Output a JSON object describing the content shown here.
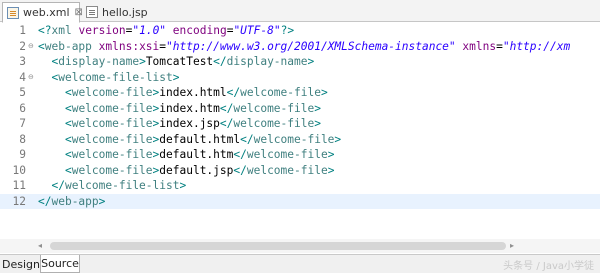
{
  "tabs": [
    {
      "label": "web.xml",
      "active": true,
      "icon": "xml-file-icon",
      "close": "⊠"
    },
    {
      "label": "hello.jsp",
      "active": false,
      "icon": "jsp-file-icon"
    }
  ],
  "editor": {
    "current_line": 12,
    "lines": [
      {
        "n": "1",
        "fold": "",
        "tokens": [
          {
            "t": "br",
            "v": "<?"
          },
          {
            "t": "tag",
            "v": "xml"
          },
          {
            "t": "txt",
            "v": " "
          },
          {
            "t": "attr",
            "v": "version"
          },
          {
            "t": "eq",
            "v": "="
          },
          {
            "t": "val",
            "v": "\"1.0\""
          },
          {
            "t": "txt",
            "v": " "
          },
          {
            "t": "attr",
            "v": "encoding"
          },
          {
            "t": "eq",
            "v": "="
          },
          {
            "t": "val",
            "v": "\"UTF-8\""
          },
          {
            "t": "br",
            "v": "?>"
          }
        ]
      },
      {
        "n": "2",
        "fold": "⊖",
        "tokens": [
          {
            "t": "br",
            "v": "<"
          },
          {
            "t": "tag",
            "v": "web-app"
          },
          {
            "t": "txt",
            "v": " "
          },
          {
            "t": "attr",
            "v": "xmlns:xsi"
          },
          {
            "t": "eq",
            "v": "="
          },
          {
            "t": "val",
            "v": "\"http://www.w3.org/2001/XMLSchema-instance\""
          },
          {
            "t": "txt",
            "v": " "
          },
          {
            "t": "attr",
            "v": "xmlns"
          },
          {
            "t": "eq",
            "v": "="
          },
          {
            "t": "val",
            "v": "\"http://xm"
          }
        ]
      },
      {
        "n": "3",
        "fold": "",
        "tokens": [
          {
            "t": "txt",
            "v": "  "
          },
          {
            "t": "br",
            "v": "<"
          },
          {
            "t": "tag",
            "v": "display-name"
          },
          {
            "t": "br",
            "v": ">"
          },
          {
            "t": "txt",
            "v": "TomcatTest"
          },
          {
            "t": "br",
            "v": "</"
          },
          {
            "t": "tag",
            "v": "display-name"
          },
          {
            "t": "br",
            "v": ">"
          }
        ]
      },
      {
        "n": "4",
        "fold": "⊖",
        "tokens": [
          {
            "t": "txt",
            "v": "  "
          },
          {
            "t": "br",
            "v": "<"
          },
          {
            "t": "tag",
            "v": "welcome-file-list"
          },
          {
            "t": "br",
            "v": ">"
          }
        ]
      },
      {
        "n": "5",
        "fold": "",
        "tokens": [
          {
            "t": "txt",
            "v": "    "
          },
          {
            "t": "br",
            "v": "<"
          },
          {
            "t": "tag",
            "v": "welcome-file"
          },
          {
            "t": "br",
            "v": ">"
          },
          {
            "t": "txt",
            "v": "index.html"
          },
          {
            "t": "br",
            "v": "</"
          },
          {
            "t": "tag",
            "v": "welcome-file"
          },
          {
            "t": "br",
            "v": ">"
          }
        ]
      },
      {
        "n": "6",
        "fold": "",
        "tokens": [
          {
            "t": "txt",
            "v": "    "
          },
          {
            "t": "br",
            "v": "<"
          },
          {
            "t": "tag",
            "v": "welcome-file"
          },
          {
            "t": "br",
            "v": ">"
          },
          {
            "t": "txt",
            "v": "index.htm"
          },
          {
            "t": "br",
            "v": "</"
          },
          {
            "t": "tag",
            "v": "welcome-file"
          },
          {
            "t": "br",
            "v": ">"
          }
        ]
      },
      {
        "n": "7",
        "fold": "",
        "tokens": [
          {
            "t": "txt",
            "v": "    "
          },
          {
            "t": "br",
            "v": "<"
          },
          {
            "t": "tag",
            "v": "welcome-file"
          },
          {
            "t": "br",
            "v": ">"
          },
          {
            "t": "txt",
            "v": "index.jsp"
          },
          {
            "t": "br",
            "v": "</"
          },
          {
            "t": "tag",
            "v": "welcome-file"
          },
          {
            "t": "br",
            "v": ">"
          }
        ]
      },
      {
        "n": "8",
        "fold": "",
        "tokens": [
          {
            "t": "txt",
            "v": "    "
          },
          {
            "t": "br",
            "v": "<"
          },
          {
            "t": "tag",
            "v": "welcome-file"
          },
          {
            "t": "br",
            "v": ">"
          },
          {
            "t": "txt",
            "v": "default.html"
          },
          {
            "t": "br",
            "v": "</"
          },
          {
            "t": "tag",
            "v": "welcome-file"
          },
          {
            "t": "br",
            "v": ">"
          }
        ]
      },
      {
        "n": "9",
        "fold": "",
        "tokens": [
          {
            "t": "txt",
            "v": "    "
          },
          {
            "t": "br",
            "v": "<"
          },
          {
            "t": "tag",
            "v": "welcome-file"
          },
          {
            "t": "br",
            "v": ">"
          },
          {
            "t": "txt",
            "v": "default.htm"
          },
          {
            "t": "br",
            "v": "</"
          },
          {
            "t": "tag",
            "v": "welcome-file"
          },
          {
            "t": "br",
            "v": ">"
          }
        ]
      },
      {
        "n": "10",
        "fold": "",
        "tokens": [
          {
            "t": "txt",
            "v": "    "
          },
          {
            "t": "br",
            "v": "<"
          },
          {
            "t": "tag",
            "v": "welcome-file"
          },
          {
            "t": "br",
            "v": ">"
          },
          {
            "t": "txt",
            "v": "default.jsp"
          },
          {
            "t": "br",
            "v": "</"
          },
          {
            "t": "tag",
            "v": "welcome-file"
          },
          {
            "t": "br",
            "v": ">"
          }
        ]
      },
      {
        "n": "11",
        "fold": "",
        "tokens": [
          {
            "t": "txt",
            "v": "  "
          },
          {
            "t": "br",
            "v": "</"
          },
          {
            "t": "tag",
            "v": "welcome-file-list"
          },
          {
            "t": "br",
            "v": ">"
          }
        ]
      },
      {
        "n": "12",
        "fold": "",
        "tokens": [
          {
            "t": "br",
            "v": "</"
          },
          {
            "t": "tag",
            "v": "web-app"
          },
          {
            "t": "br",
            "v": ">"
          }
        ]
      }
    ]
  },
  "scrollbar": {
    "left_arrow": "◂",
    "right_arrow": "▸"
  },
  "bottom_tabs": {
    "design": "Design",
    "source": "Source",
    "active": "Source"
  },
  "watermark": "头条号 / Java小学徒"
}
